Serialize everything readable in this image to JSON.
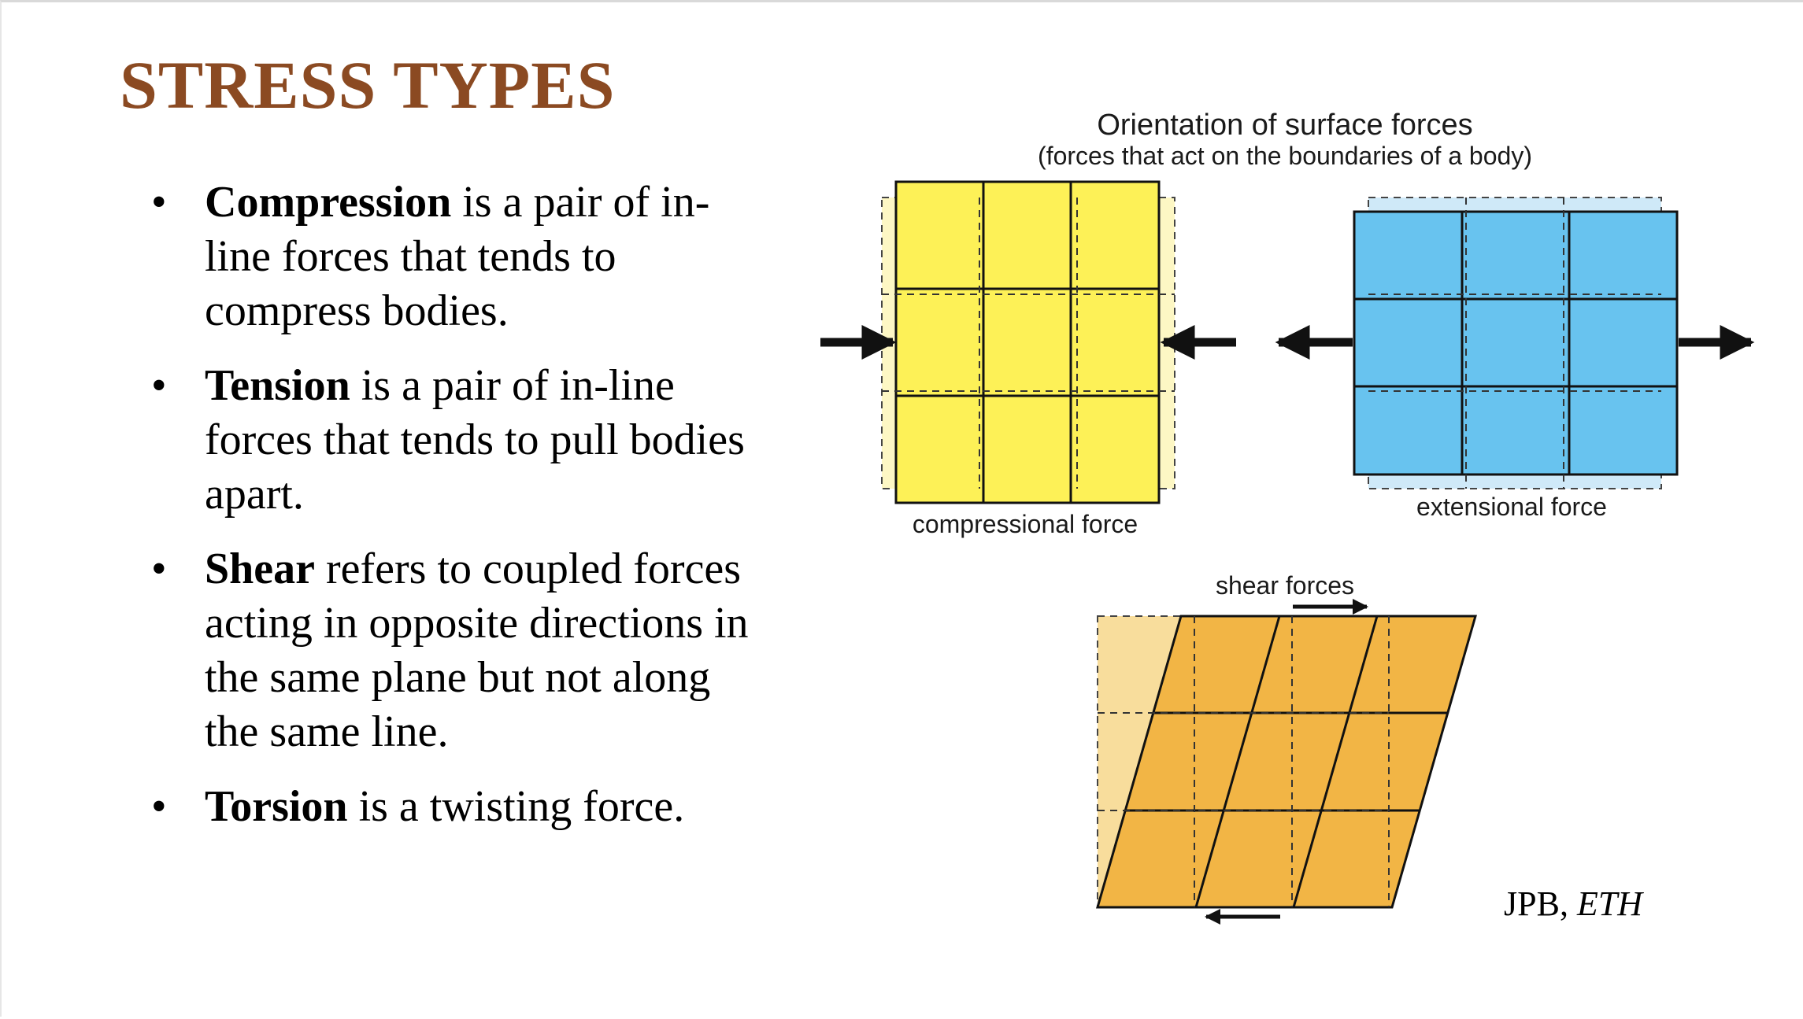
{
  "slide": {
    "title": "STRESS TYPES",
    "bullets": [
      {
        "term": "Compression",
        "line1": " is a pair of in-",
        "line2": "line forces that tends to",
        "line3": "compress bodies."
      },
      {
        "term": "Tension",
        "line1": " is a pair of in-line",
        "line2": "forces that tends to pull bodies",
        "line3": "apart."
      },
      {
        "term": "Shear",
        "line1": " refers to coupled forces",
        "line2": "acting in opposite directions in",
        "line3": "the same plane but not along",
        "line4": "the same line."
      },
      {
        "term": "Torsion",
        "line1": " is a twisting force."
      }
    ],
    "credit": {
      "author": "JPB, ",
      "institution": "ETH"
    }
  },
  "figure": {
    "heading": "Orientation of surface forces",
    "subheading": "(forces that act on the boundaries of a body)",
    "compression_label": "compressional force",
    "extension_label": "extensional force",
    "shear_label": "shear forces",
    "colors": {
      "compression": "#fdf157",
      "compression_ghost": "#fdf7c4",
      "extension": "#68c3ef",
      "extension_ghost": "#cfe9f8",
      "shear": "#f2b545",
      "shear_ghost": "#f8dd9c",
      "title": "#8b4a22"
    }
  }
}
